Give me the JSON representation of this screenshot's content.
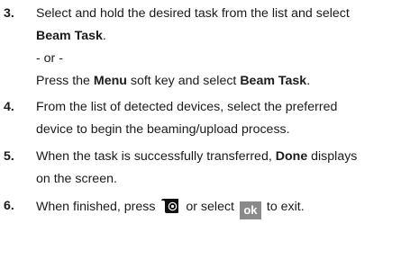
{
  "steps": [
    {
      "number": "3.",
      "line1": "Select and hold the desired task from the list and select",
      "line2_bold": "Beam Task",
      "line2_end": ".",
      "or_text": "- or -",
      "line4_a": "Press the ",
      "line4_b1": "Menu",
      "line4_c": " soft key and select ",
      "line4_b2": "Beam Task",
      "line4_d": "."
    },
    {
      "number": "4.",
      "line1": "From the list of detected devices, select the preferred",
      "line2": "device to begin the beaming/upload process."
    },
    {
      "number": "5.",
      "line1_a": "When the task is successfully transferred, ",
      "line1_b": "Done",
      "line1_c": " displays",
      "line2": "on the screen."
    },
    {
      "number": "6.",
      "text_a": "When finished, press ",
      "text_b": " or select ",
      "ok_label": "ok",
      "text_c": " to exit."
    }
  ],
  "icons": {
    "end_key": "end-key-icon",
    "ok_key": "ok-key-icon"
  },
  "colors": {
    "text": "#1a1a1a",
    "ok_key_bg": "#8a8a8a"
  }
}
